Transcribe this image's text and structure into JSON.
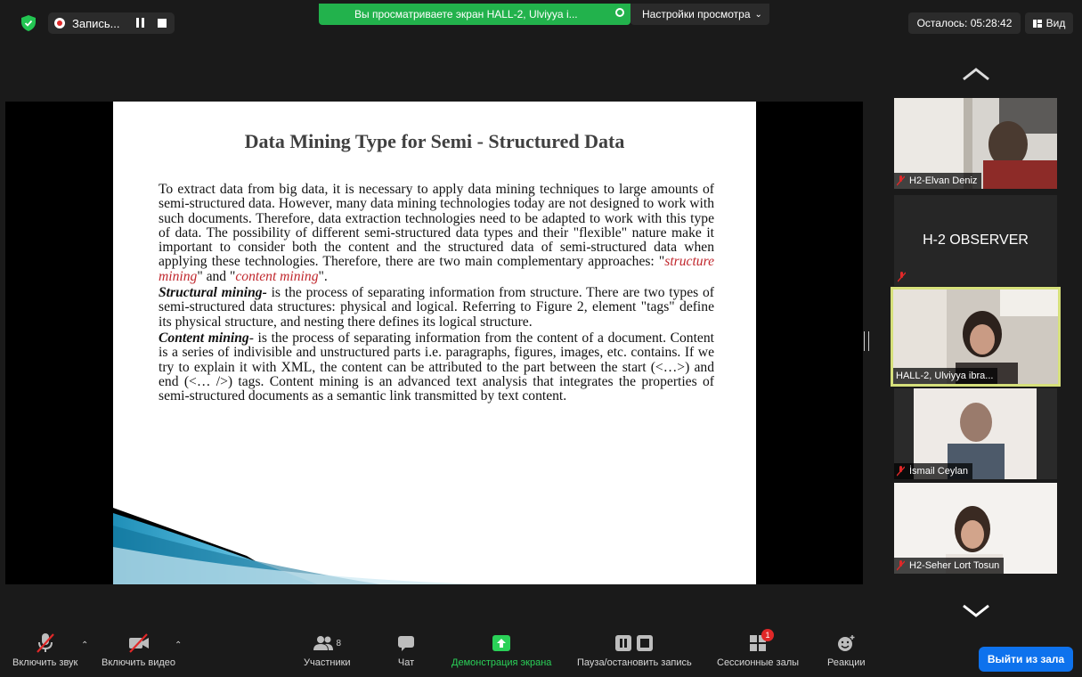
{
  "topbar": {
    "recording_label": "Запись...",
    "share_banner_text": "Вы просматриваете экран HALL-2, Ulviyya i...",
    "view_settings_label": "Настройки просмотра",
    "timer_text": "Осталось: 05:28:42",
    "view_label": "Вид",
    "colors": {
      "share_banner": "#22b24c",
      "security": "#23c552",
      "recording": "#e02828"
    }
  },
  "slide": {
    "title": "Data Mining Type for Semi - Structured Data",
    "para1": "To extract data from big data, it is necessary to apply data mining techniques to large amounts of semi-structured data. However, many data mining technologies today are not designed to work with such documents. Therefore, data extraction technologies need to be adapted to work with this type of data. The possibility of different semi-structured data types and their \"flexible\" nature make it important to consider both the content and the structured data of semi-structured data when applying these technologies. Therefore, there are two main complementary approaches:",
    "approach1": "structure mining",
    "approach2": "content mining",
    "para2_term": "Structural mining-",
    "para2_text": "is the process of separating information from structure. There are two types of semi-structured data structures: physical and logical. Referring to Figure 2, element \"tags\" define its physical structure, and nesting there defines its logical structure.",
    "para3_term": "Content mining",
    "para3_text": "- is the process of separating information from the content of a document. Content is a series of indivisible and unstructured parts i.e. paragraphs, figures, images, etc. contains. If we try to explain it with XML, the content can be attributed to the part between the start (<…>) and end (<… />) tags. Content mining is an advanced text analysis that integrates the properties of semi-structured documents as a semantic link transmitted by text content.",
    "colors": {
      "title": "#404040",
      "highlight": "#c0272d",
      "deco_blue": "#1f8fb8"
    }
  },
  "participants_panel": {
    "tiles": [
      {
        "name": "H2-Elvan Deniz"
      },
      {
        "name": "H-2 OBSERVER"
      },
      {
        "name": "HALL-2, Ulviyya ibra..."
      },
      {
        "name": "İsmail Ceylan"
      },
      {
        "name": "H2-Seher Lort Tosun"
      }
    ],
    "active_speaker_color": "#d6e07b"
  },
  "toolbar": {
    "unmute_label": "Включить звук",
    "start_video_label": "Включить видео",
    "participants_label": "Участники",
    "participants_count": "8",
    "chat_label": "Чат",
    "share_screen_label": "Демонстрация экрана",
    "pause_record_label": "Пауза/остановить запись",
    "breakout_label": "Сессионные залы",
    "breakout_badge": "1",
    "reactions_label": "Реакции",
    "leave_label": "Выйти из зала",
    "colors": {
      "share": "#2ad158",
      "leave": "#0e72ed"
    }
  }
}
